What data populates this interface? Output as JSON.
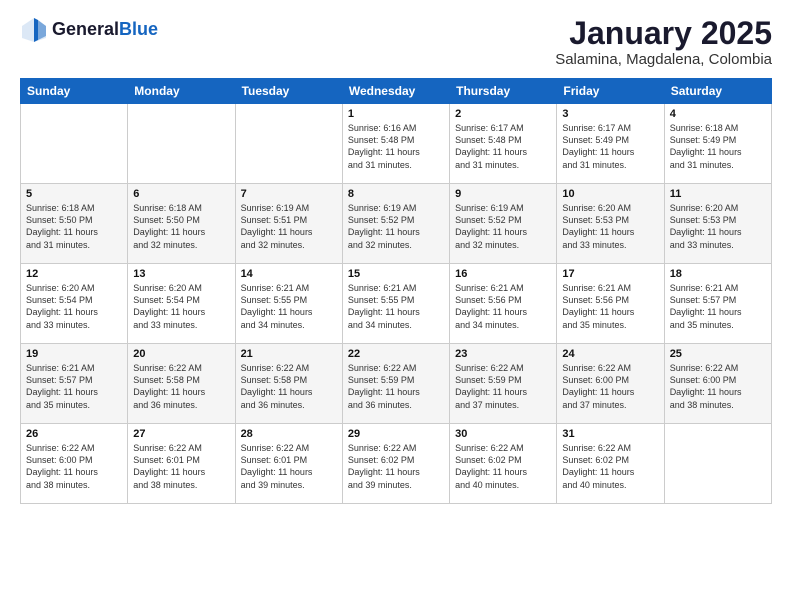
{
  "header": {
    "logo_general": "General",
    "logo_blue": "Blue",
    "month": "January 2025",
    "location": "Salamina, Magdalena, Colombia"
  },
  "days_of_week": [
    "Sunday",
    "Monday",
    "Tuesday",
    "Wednesday",
    "Thursday",
    "Friday",
    "Saturday"
  ],
  "weeks": [
    [
      {
        "day": "",
        "info": ""
      },
      {
        "day": "",
        "info": ""
      },
      {
        "day": "",
        "info": ""
      },
      {
        "day": "1",
        "info": "Sunrise: 6:16 AM\nSunset: 5:48 PM\nDaylight: 11 hours\nand 31 minutes."
      },
      {
        "day": "2",
        "info": "Sunrise: 6:17 AM\nSunset: 5:48 PM\nDaylight: 11 hours\nand 31 minutes."
      },
      {
        "day": "3",
        "info": "Sunrise: 6:17 AM\nSunset: 5:49 PM\nDaylight: 11 hours\nand 31 minutes."
      },
      {
        "day": "4",
        "info": "Sunrise: 6:18 AM\nSunset: 5:49 PM\nDaylight: 11 hours\nand 31 minutes."
      }
    ],
    [
      {
        "day": "5",
        "info": "Sunrise: 6:18 AM\nSunset: 5:50 PM\nDaylight: 11 hours\nand 31 minutes."
      },
      {
        "day": "6",
        "info": "Sunrise: 6:18 AM\nSunset: 5:50 PM\nDaylight: 11 hours\nand 32 minutes."
      },
      {
        "day": "7",
        "info": "Sunrise: 6:19 AM\nSunset: 5:51 PM\nDaylight: 11 hours\nand 32 minutes."
      },
      {
        "day": "8",
        "info": "Sunrise: 6:19 AM\nSunset: 5:52 PM\nDaylight: 11 hours\nand 32 minutes."
      },
      {
        "day": "9",
        "info": "Sunrise: 6:19 AM\nSunset: 5:52 PM\nDaylight: 11 hours\nand 32 minutes."
      },
      {
        "day": "10",
        "info": "Sunrise: 6:20 AM\nSunset: 5:53 PM\nDaylight: 11 hours\nand 33 minutes."
      },
      {
        "day": "11",
        "info": "Sunrise: 6:20 AM\nSunset: 5:53 PM\nDaylight: 11 hours\nand 33 minutes."
      }
    ],
    [
      {
        "day": "12",
        "info": "Sunrise: 6:20 AM\nSunset: 5:54 PM\nDaylight: 11 hours\nand 33 minutes."
      },
      {
        "day": "13",
        "info": "Sunrise: 6:20 AM\nSunset: 5:54 PM\nDaylight: 11 hours\nand 33 minutes."
      },
      {
        "day": "14",
        "info": "Sunrise: 6:21 AM\nSunset: 5:55 PM\nDaylight: 11 hours\nand 34 minutes."
      },
      {
        "day": "15",
        "info": "Sunrise: 6:21 AM\nSunset: 5:55 PM\nDaylight: 11 hours\nand 34 minutes."
      },
      {
        "day": "16",
        "info": "Sunrise: 6:21 AM\nSunset: 5:56 PM\nDaylight: 11 hours\nand 34 minutes."
      },
      {
        "day": "17",
        "info": "Sunrise: 6:21 AM\nSunset: 5:56 PM\nDaylight: 11 hours\nand 35 minutes."
      },
      {
        "day": "18",
        "info": "Sunrise: 6:21 AM\nSunset: 5:57 PM\nDaylight: 11 hours\nand 35 minutes."
      }
    ],
    [
      {
        "day": "19",
        "info": "Sunrise: 6:21 AM\nSunset: 5:57 PM\nDaylight: 11 hours\nand 35 minutes."
      },
      {
        "day": "20",
        "info": "Sunrise: 6:22 AM\nSunset: 5:58 PM\nDaylight: 11 hours\nand 36 minutes."
      },
      {
        "day": "21",
        "info": "Sunrise: 6:22 AM\nSunset: 5:58 PM\nDaylight: 11 hours\nand 36 minutes."
      },
      {
        "day": "22",
        "info": "Sunrise: 6:22 AM\nSunset: 5:59 PM\nDaylight: 11 hours\nand 36 minutes."
      },
      {
        "day": "23",
        "info": "Sunrise: 6:22 AM\nSunset: 5:59 PM\nDaylight: 11 hours\nand 37 minutes."
      },
      {
        "day": "24",
        "info": "Sunrise: 6:22 AM\nSunset: 6:00 PM\nDaylight: 11 hours\nand 37 minutes."
      },
      {
        "day": "25",
        "info": "Sunrise: 6:22 AM\nSunset: 6:00 PM\nDaylight: 11 hours\nand 38 minutes."
      }
    ],
    [
      {
        "day": "26",
        "info": "Sunrise: 6:22 AM\nSunset: 6:00 PM\nDaylight: 11 hours\nand 38 minutes."
      },
      {
        "day": "27",
        "info": "Sunrise: 6:22 AM\nSunset: 6:01 PM\nDaylight: 11 hours\nand 38 minutes."
      },
      {
        "day": "28",
        "info": "Sunrise: 6:22 AM\nSunset: 6:01 PM\nDaylight: 11 hours\nand 39 minutes."
      },
      {
        "day": "29",
        "info": "Sunrise: 6:22 AM\nSunset: 6:02 PM\nDaylight: 11 hours\nand 39 minutes."
      },
      {
        "day": "30",
        "info": "Sunrise: 6:22 AM\nSunset: 6:02 PM\nDaylight: 11 hours\nand 40 minutes."
      },
      {
        "day": "31",
        "info": "Sunrise: 6:22 AM\nSunset: 6:02 PM\nDaylight: 11 hours\nand 40 minutes."
      },
      {
        "day": "",
        "info": ""
      }
    ]
  ]
}
